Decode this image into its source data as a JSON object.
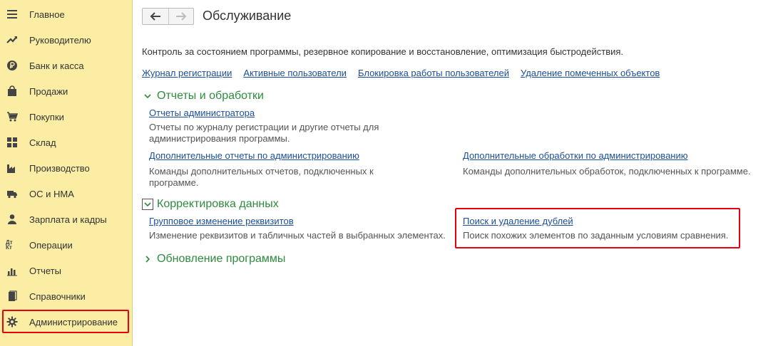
{
  "sidebar": {
    "items": [
      {
        "label": "Главное",
        "icon": "menu-icon"
      },
      {
        "label": "Руководителю",
        "icon": "trend-icon"
      },
      {
        "label": "Банк и касса",
        "icon": "ruble-icon"
      },
      {
        "label": "Продажи",
        "icon": "shopping-bag-icon"
      },
      {
        "label": "Покупки",
        "icon": "cart-icon"
      },
      {
        "label": "Склад",
        "icon": "warehouse-grid-icon"
      },
      {
        "label": "Производство",
        "icon": "factory-icon"
      },
      {
        "label": "ОС и НМА",
        "icon": "truck-icon"
      },
      {
        "label": "Зарплата и кадры",
        "icon": "person-icon"
      },
      {
        "label": "Операции",
        "icon": "debit-credit-icon"
      },
      {
        "label": "Отчеты",
        "icon": "bar-chart-icon"
      },
      {
        "label": "Справочники",
        "icon": "books-icon"
      },
      {
        "label": "Администрирование",
        "icon": "gear-icon"
      }
    ],
    "icon_glyph_operations": "Дт Кт"
  },
  "header": {
    "title": "Обслуживание",
    "back_icon": "arrow-left-icon",
    "forward_icon": "arrow-right-icon"
  },
  "description": "Контроль за состоянием программы, резервное копирование и восстановление, оптимизация быстродействия.",
  "top_links": [
    "Журнал регистрации",
    "Активные пользователи",
    "Блокировка работы пользователей",
    "Удаление помеченных объектов"
  ],
  "sections": {
    "reports": {
      "title": "Отчеты и обработки",
      "items": [
        {
          "link": "Отчеты администратора",
          "desc1": "Отчеты по журналу регистрации и другие отчеты для",
          "desc2": "администрирования программы."
        },
        {
          "link": "Дополнительные отчеты по администрированию",
          "desc1": "Команды дополнительных отчетов, подключенных к",
          "desc2": "программе."
        },
        {
          "link": "Дополнительные обработки по администрированию",
          "desc1": "Команды дополнительных обработок, подключенных к программе."
        }
      ]
    },
    "correction": {
      "title": "Корректировка данных",
      "items": [
        {
          "link": "Групповое изменение реквизитов",
          "desc1": "Изменение реквизитов и табличных частей в выбранных элементах."
        },
        {
          "link": "Поиск и удаление дублей",
          "desc1": "Поиск похожих элементов по заданным условиям сравнения."
        }
      ]
    },
    "update": {
      "title": "Обновление программы"
    }
  },
  "colors": {
    "sidebar_bg": "#fbeda4",
    "link": "#1a4f9c",
    "section_title": "#2e8b3d",
    "highlight": "#e8000d"
  }
}
